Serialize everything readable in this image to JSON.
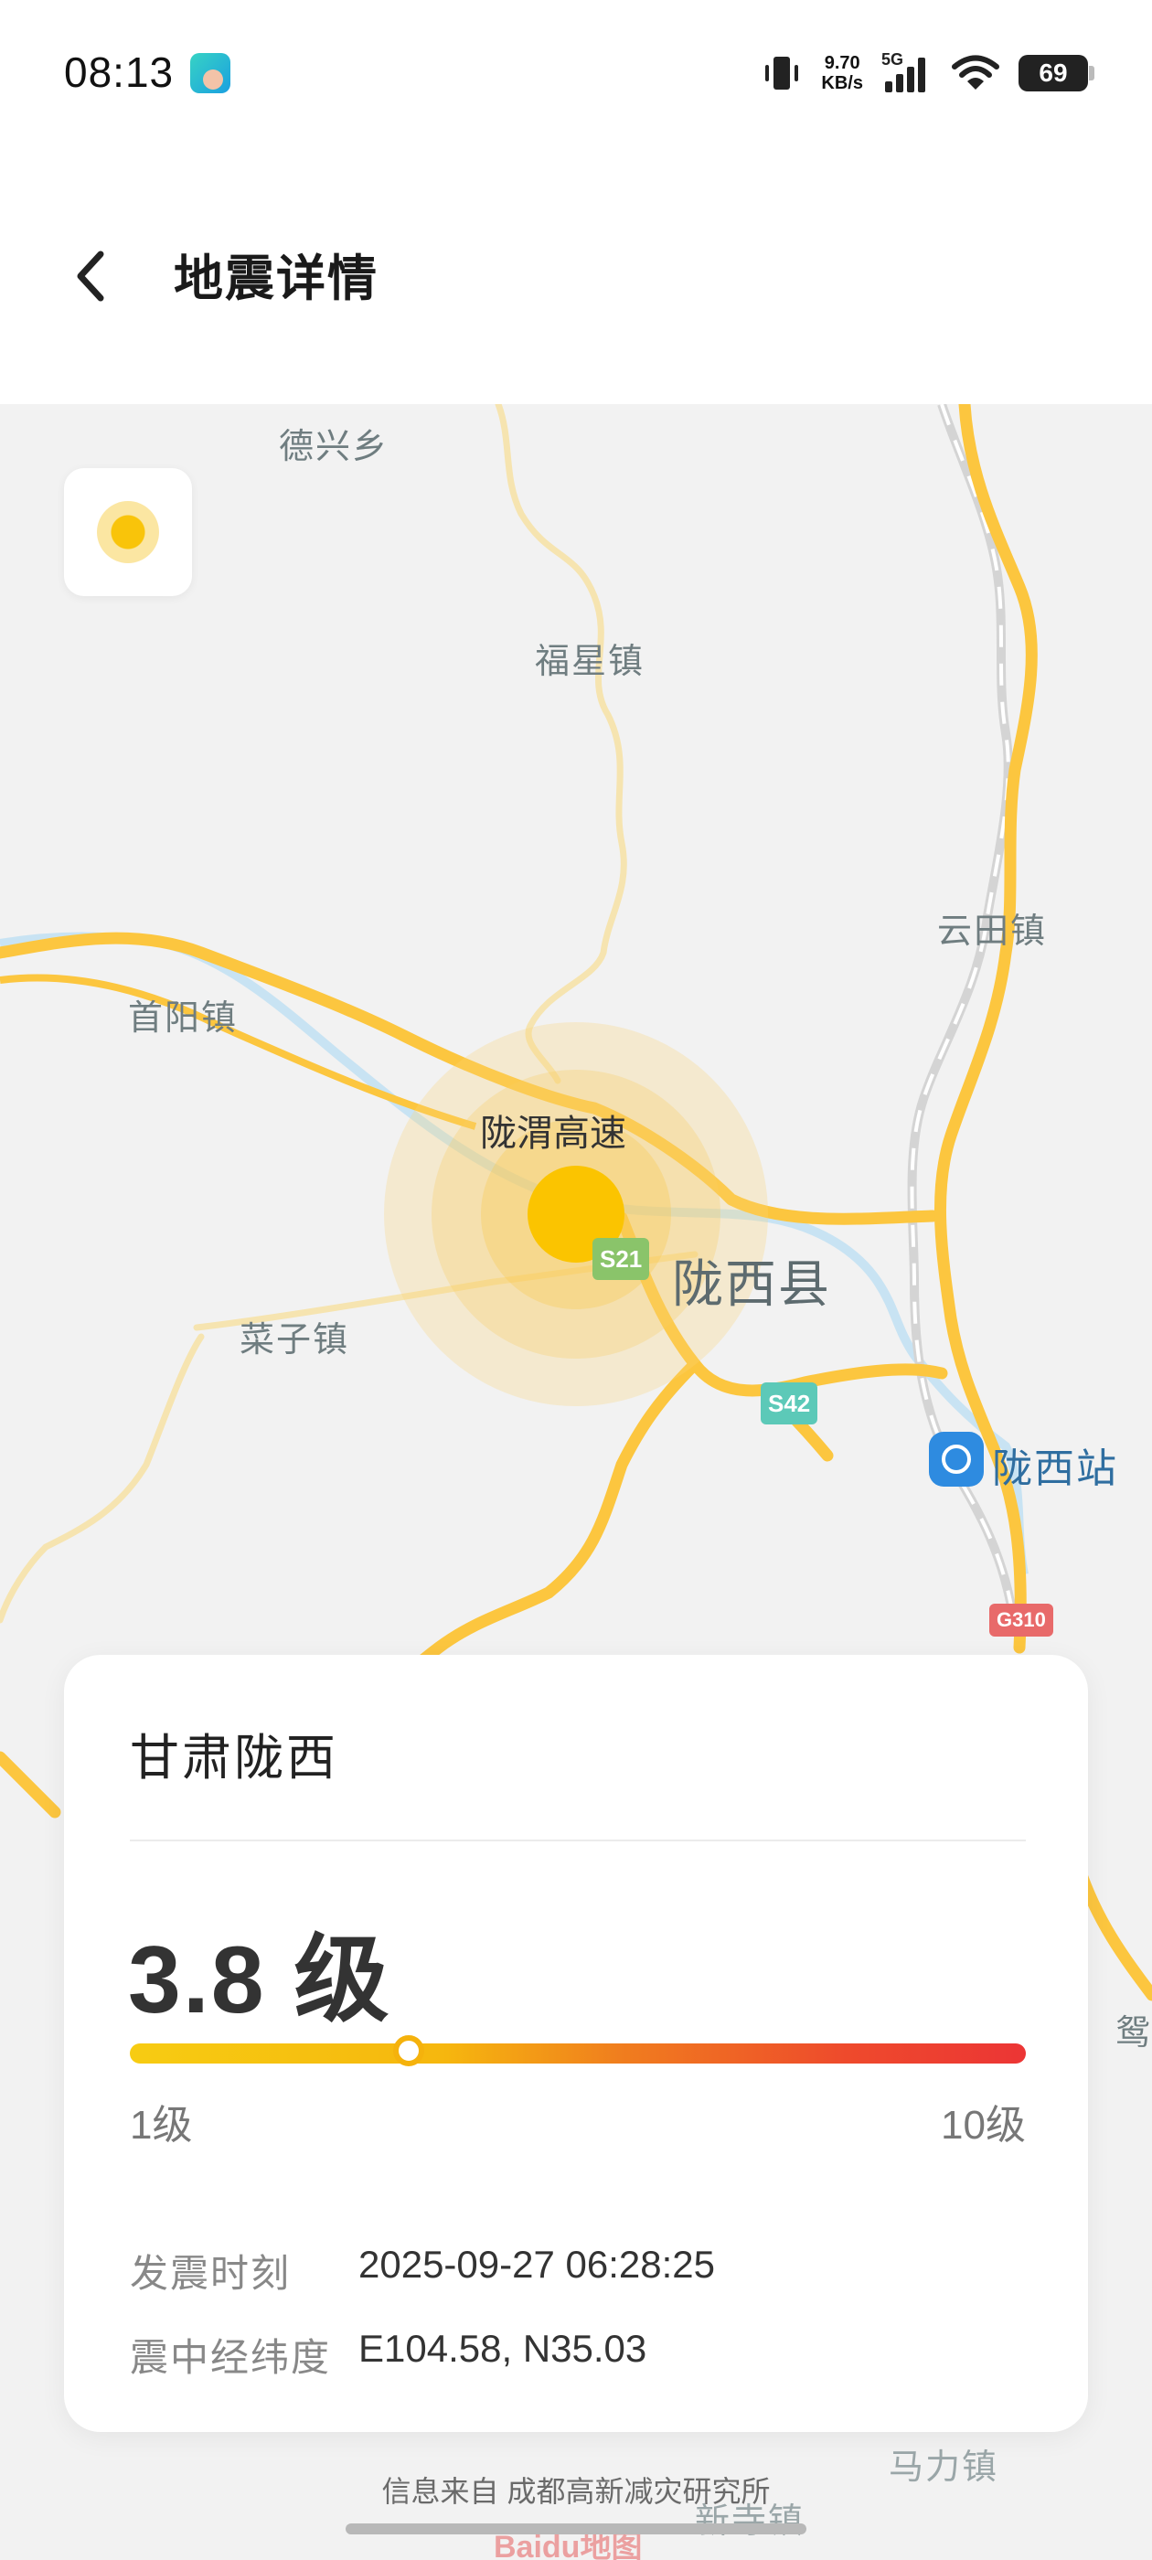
{
  "status_bar": {
    "time": "08:13",
    "network_speed_value": "9.70",
    "network_speed_unit": "KB/s",
    "network_type": "5G",
    "battery": "69",
    "icons": [
      "vibrate-icon",
      "signal-icon",
      "wifi-icon",
      "battery-icon"
    ]
  },
  "header": {
    "title": "地震详情",
    "back_icon": "chevron-left-icon"
  },
  "map": {
    "places": {
      "dexing": "德兴乡",
      "fuxing": "福星镇",
      "yuntian": "云田镇",
      "shouyang": "首阳镇",
      "caizi": "菜子镇",
      "longxi": "陇西县",
      "mali": "马力镇",
      "xinsi": "新寺镇",
      "edge": "鸳"
    },
    "road_name": "陇渭高速",
    "station": "陇西站",
    "shields": {
      "s21": "S21",
      "s42": "S42",
      "g310": "G310"
    },
    "layer_icon": "epicenter-layer-icon",
    "watermark": "Baidu地图",
    "colors": {
      "road": "#fcc63f",
      "epicenter": "#fbc400"
    }
  },
  "earthquake": {
    "location": "甘肃陇西",
    "magnitude": "3.8 级",
    "magnitude_value": 3.8,
    "scale_min_label": "1级",
    "scale_max_label": "10级",
    "scale_min": 1,
    "scale_max": 10,
    "time_label": "发震时刻",
    "time_value": "2025-09-27 06:28:25",
    "coords_label": "震中经纬度",
    "coords_value": "E104.58, N35.03"
  },
  "footer": {
    "source": "信息来自 成都高新减灾研究所"
  }
}
